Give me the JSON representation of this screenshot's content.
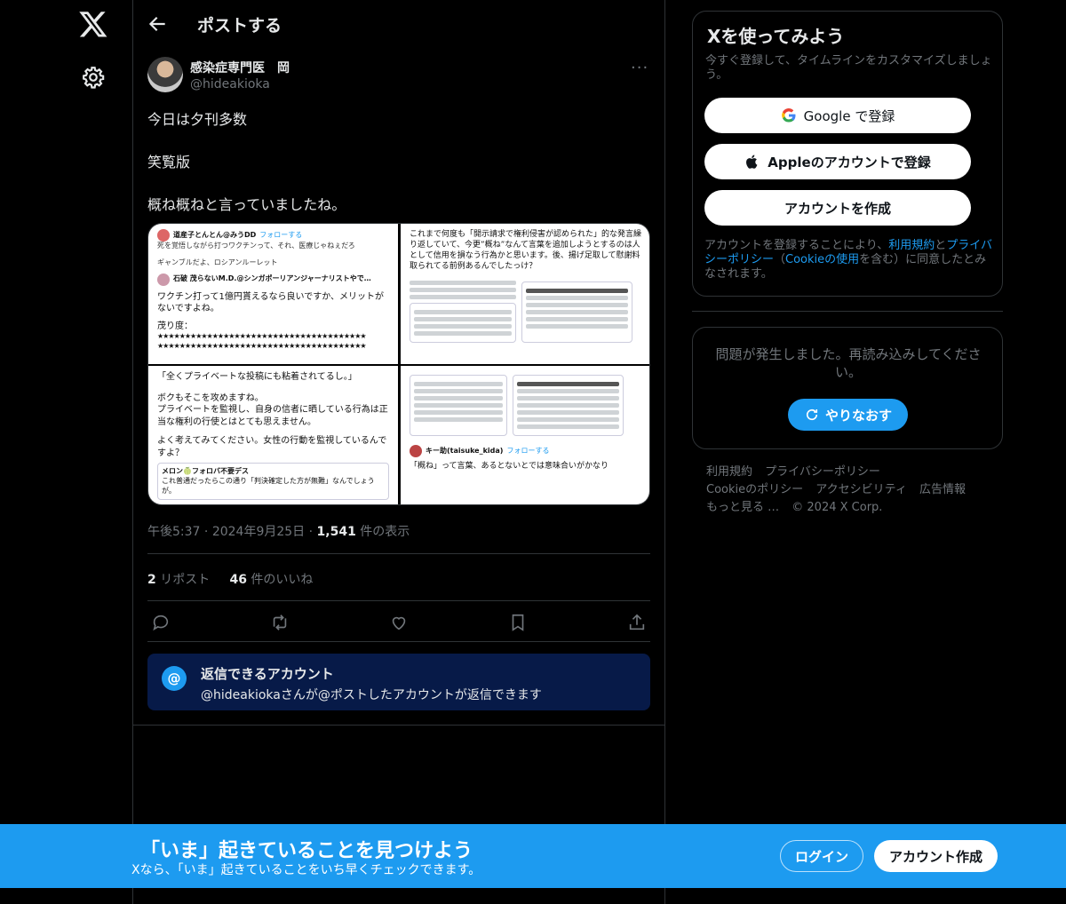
{
  "header": {
    "title": "ポストする"
  },
  "post": {
    "author_name": "感染症専門医　岡",
    "author_handle": "@hideakioka",
    "lines": [
      "今日は夕刊多数",
      "笑覧版",
      "概ね概ねと言っていましたね。"
    ],
    "time": "午後5:37",
    "date": "2024年9月25日",
    "views": "1,541",
    "views_label": "件の表示",
    "reposts": "2",
    "reposts_label": "リポスト",
    "likes": "46",
    "likes_label": "件のいいね",
    "media": {
      "c1_user1": "道産子とんとん@みうDD",
      "c1_follow": "フォローする",
      "c1_text1": "死を覚悟しながら打つワクチンって、それ、医療じゃねぇだろ",
      "c1_text2": "ギャンブルだよ、ロシアンルーレット",
      "c1_user2": "石破 茂らないM.D.@シンガポーリアンジャーナリストやで…",
      "c1_follow2": "フォローする",
      "c1_main": "ワクチン打って1億円貰えるなら良いですか、メリットがないですよね。",
      "c1_label": "茂り度：",
      "c1_stars": "★★★★★★★★★★★★★★★★★★★★★★★★★★★★★★★★★★★★★★",
      "c2_text": "これまで何度も「開示請求で権利侵害が認められた」的な発言繰り返していて、今更”概ね”なんて言葉を追加しようとするのは人として信用を損なう行為かと思います。後、揚げ足取して慰謝料取られてる前例あるんでしたっけ？",
      "c3_text1": "「全くプライベートな投稿にも粘着されてるし。」",
      "c3_text2": "ボクもそこを攻めますね。",
      "c3_text3": "プライベートを監視し、自身の信者に晒している行為は正当な権利の行使とはとても思えません。",
      "c3_text4": "よく考えてみてください。女性の行動を監視しているんですよ？",
      "c3_user": "メロン🍈フォロバ不要デス",
      "c3_reply": "これ普通だったらこの通り「判決確定した方が無難」なんでしょうが。",
      "c4_user": "キー助(taisuke_kida)",
      "c4_follow": "フォローする",
      "c4_text": "「概ね」って言葉、あるとないとでは意味合いがかなり"
    }
  },
  "reply_settings": {
    "title": "返信できるアカウント",
    "desc": "@hideakiokaさんが@ポストしたアカウントが返信できます"
  },
  "signup_panel": {
    "title": "Xを使ってみよう",
    "subtitle": "今すぐ登録して、タイムラインをカスタマイズしましょう。",
    "google": "Google で登録",
    "apple": "Appleのアカウントで登録",
    "create": "アカウントを作成",
    "terms_pre": "アカウントを登録することにより、",
    "terms_link1": "利用規約",
    "terms_and": "と",
    "terms_link2": "プライバシーポリシー",
    "terms_mid": "（",
    "terms_link3": "Cookieの使用",
    "terms_post": "を含む）に同意したとみなされます。"
  },
  "error_panel": {
    "message": "問題が発生しました。再読み込みしてください。",
    "retry": "やりなおす"
  },
  "footer": {
    "links": [
      "利用規約",
      "プライバシーポリシー",
      "Cookieのポリシー",
      "アクセシビリティ",
      "広告情報",
      "もっと見る …",
      "© 2024 X Corp."
    ]
  },
  "banner": {
    "title": "「いま」起きていることを見つけよう",
    "subtitle": "Xなら、「いま」起きていることをいち早くチェックできます。",
    "login": "ログイン",
    "signup": "アカウント作成"
  },
  "colors": {
    "accent": "#1d9bf0",
    "background": "#000000",
    "muted": "#71767b",
    "reply_box": "#071a48"
  },
  "icons": [
    "x-logo-icon",
    "gear-icon",
    "back-arrow-icon",
    "more-icon",
    "reply-icon",
    "repost-icon",
    "like-icon",
    "bookmark-icon",
    "share-icon",
    "google-icon",
    "apple-icon",
    "refresh-icon"
  ]
}
